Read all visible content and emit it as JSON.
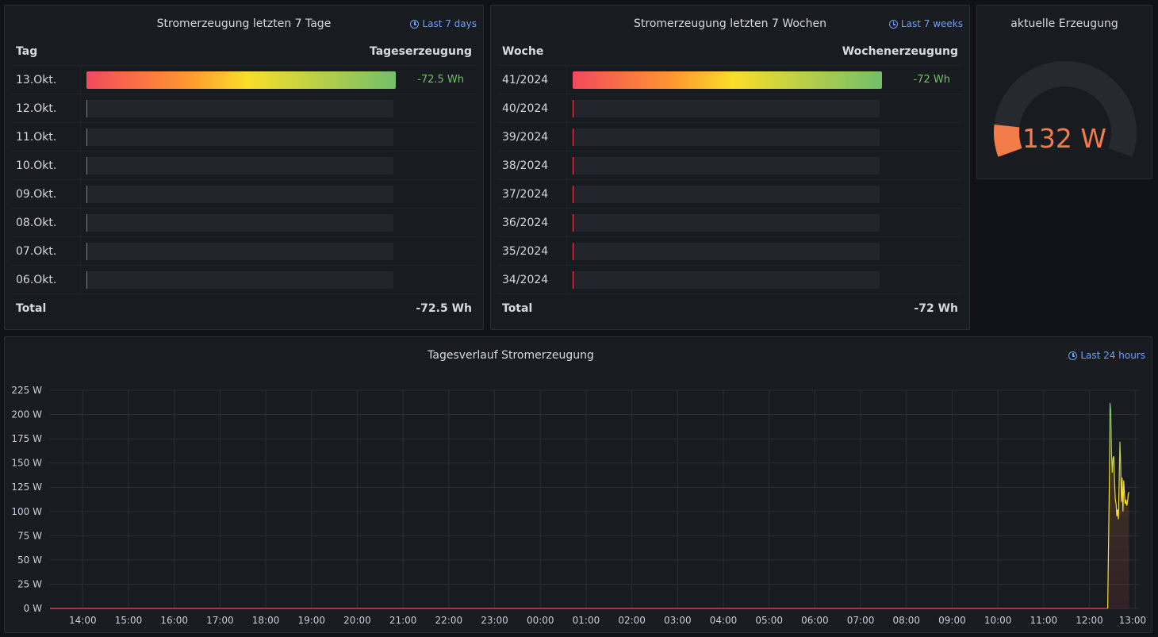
{
  "panel_days": {
    "title": "Stromerzeugung letzten 7 Tage",
    "time_range": "Last 7 days",
    "col_label": "Tag",
    "col_value": "Tageserzeugung",
    "rows": [
      {
        "label": "13.Okt.",
        "value": "-72.5 Wh",
        "fill": 1.0
      },
      {
        "label": "12.Okt.",
        "value": "",
        "fill": 0
      },
      {
        "label": "11.Okt.",
        "value": "",
        "fill": 0
      },
      {
        "label": "10.Okt.",
        "value": "",
        "fill": 0
      },
      {
        "label": "09.Okt.",
        "value": "",
        "fill": 0
      },
      {
        "label": "08.Okt.",
        "value": "",
        "fill": 0
      },
      {
        "label": "07.Okt.",
        "value": "",
        "fill": 0
      },
      {
        "label": "06.Okt.",
        "value": "",
        "fill": 0
      }
    ],
    "total_label": "Total",
    "total_value": "-72.5 Wh"
  },
  "panel_weeks": {
    "title": "Stromerzeugung letzten 7 Wochen",
    "time_range": "Last 7 weeks",
    "col_label": "Woche",
    "col_value": "Wochenerzeugung",
    "rows": [
      {
        "label": "41/2024",
        "value": "-72 Wh",
        "fill": 1.0
      },
      {
        "label": "40/2024",
        "value": "",
        "fill": 0
      },
      {
        "label": "39/2024",
        "value": "",
        "fill": 0
      },
      {
        "label": "38/2024",
        "value": "",
        "fill": 0
      },
      {
        "label": "37/2024",
        "value": "",
        "fill": 0
      },
      {
        "label": "36/2024",
        "value": "",
        "fill": 0
      },
      {
        "label": "35/2024",
        "value": "",
        "fill": 0
      },
      {
        "label": "34/2024",
        "value": "",
        "fill": 0
      }
    ],
    "total_label": "Total",
    "total_value": "-72 Wh"
  },
  "panel_gauge": {
    "title": "aktuelle Erzeugung",
    "value": "132 W",
    "fraction": 0.12,
    "color": "#f47b4a"
  },
  "panel_chart": {
    "title": "Tagesverlauf Stromerzeugung",
    "time_range": "Last 24 hours"
  },
  "chart_data": {
    "type": "line",
    "title": "Tagesverlauf Stromerzeugung",
    "xlabel": "",
    "ylabel": "",
    "unit": "W",
    "ylim": [
      0,
      225
    ],
    "y_ticks": [
      "0 W",
      "25 W",
      "50 W",
      "75 W",
      "100 W",
      "125 W",
      "150 W",
      "175 W",
      "200 W",
      "225 W"
    ],
    "x_ticks": [
      "14:00",
      "15:00",
      "16:00",
      "17:00",
      "18:00",
      "19:00",
      "20:00",
      "21:00",
      "22:00",
      "23:00",
      "00:00",
      "01:00",
      "02:00",
      "03:00",
      "04:00",
      "05:00",
      "06:00",
      "07:00",
      "08:00",
      "09:00",
      "10:00",
      "11:00",
      "12:00",
      "13:00"
    ],
    "x_range": [
      "13:17",
      "13:05"
    ],
    "grid": true,
    "series": [
      {
        "color": "#fade2a",
        "points": [
          [
            "13:17",
            0
          ],
          [
            "12:24",
            0
          ],
          [
            "12:26",
            120
          ],
          [
            "12:27",
            212
          ],
          [
            "12:28",
            205
          ],
          [
            "12:29",
            160
          ],
          [
            "12:30",
            140
          ],
          [
            "12:31",
            155
          ],
          [
            "12:32",
            157
          ],
          [
            "12:33",
            130
          ],
          [
            "12:34",
            112
          ],
          [
            "12:35",
            108
          ],
          [
            "12:36",
            95
          ],
          [
            "12:37",
            102
          ],
          [
            "12:38",
            92
          ],
          [
            "12:39",
            130
          ],
          [
            "12:40",
            172
          ],
          [
            "12:41",
            150
          ],
          [
            "12:42",
            110
          ],
          [
            "12:43",
            135
          ],
          [
            "12:44",
            100
          ],
          [
            "12:45",
            132
          ],
          [
            "12:46",
            118
          ],
          [
            "12:47",
            108
          ],
          [
            "12:48",
            112
          ],
          [
            "12:49",
            106
          ],
          [
            "12:50",
            110
          ],
          [
            "12:51",
            118
          ],
          [
            "12:52",
            120
          ]
        ]
      }
    ]
  }
}
